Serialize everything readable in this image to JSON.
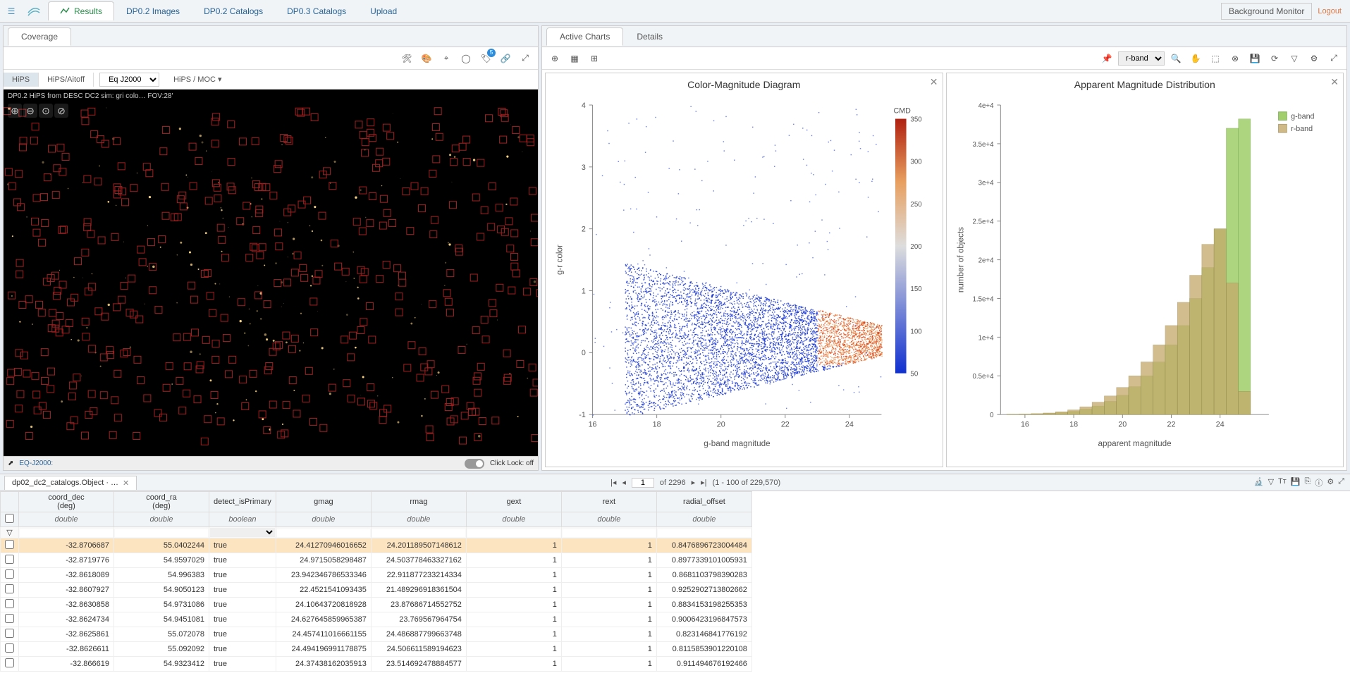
{
  "topbar": {
    "tabs": [
      {
        "label": "Results",
        "active": true
      },
      {
        "label": "DP0.2 Images"
      },
      {
        "label": "DP0.2 Catalogs"
      },
      {
        "label": "DP0.3 Catalogs"
      },
      {
        "label": "Upload"
      }
    ],
    "bg_monitor": "Background Monitor",
    "logout": "Logout"
  },
  "coverage": {
    "tab_label": "Coverage",
    "hips_label": "HiPS",
    "aitoff_label": "HiPS/Aitoff",
    "projection": "Eq J2000",
    "moc_label": "HiPS / MOC",
    "overlay_text": "DP0.2 HiPS from DESC DC2 sim: gri colo…   FOV:28'",
    "bottom_proj": "EQ-J2000:",
    "click_lock": "Click Lock: off",
    "layer_badge": "5"
  },
  "charts_panel": {
    "subtabs": [
      {
        "label": "Active Charts",
        "active": true
      },
      {
        "label": "Details"
      }
    ],
    "band_selector": "r-band",
    "chart1_title": "Color-Magnitude Diagram",
    "chart2_title": "Apparent Magnitude Distribution"
  },
  "chart_data": [
    {
      "type": "heatmap",
      "title": "Color-Magnitude Diagram",
      "xlabel": "g-band magnitude",
      "ylabel": "g-r color",
      "color_label": "CMD",
      "xlim": [
        16,
        25
      ],
      "ylim": [
        -1,
        4
      ],
      "xticks": [
        16,
        18,
        20,
        22,
        24
      ],
      "yticks": [
        -1,
        0,
        1,
        2,
        3,
        4
      ],
      "colorbar_ticks": [
        50,
        100,
        150,
        200,
        250,
        300,
        350
      ]
    },
    {
      "type": "bar",
      "title": "Apparent Magnitude Distribution",
      "xlabel": "apparent magnitude",
      "ylabel": "number of objects",
      "xlim": [
        15,
        26
      ],
      "ylim": [
        0,
        40000
      ],
      "xticks": [
        16,
        18,
        20,
        22,
        24
      ],
      "yticks": [
        0,
        5000,
        10000,
        15000,
        20000,
        25000,
        30000,
        35000,
        40000
      ],
      "ytick_labels": [
        "0",
        "0.5e+4",
        "1e+4",
        "1.5e+4",
        "2e+4",
        "2.5e+4",
        "3e+4",
        "3.5e+4",
        "4e+4"
      ],
      "legend": [
        "g-band",
        "r-band"
      ],
      "categories": [
        15.5,
        16,
        16.5,
        17,
        17.5,
        18,
        18.5,
        19,
        19.5,
        20,
        20.5,
        21,
        21.5,
        22,
        22.5,
        23,
        23.5,
        24,
        24.5,
        25
      ],
      "series": [
        {
          "name": "g-band",
          "values": [
            20,
            40,
            80,
            150,
            250,
            400,
            700,
            1100,
            1700,
            2500,
            3600,
            5000,
            6800,
            9000,
            11500,
            15000,
            19000,
            24000,
            37000,
            38200
          ]
        },
        {
          "name": "r-band",
          "values": [
            30,
            60,
            120,
            200,
            350,
            600,
            1000,
            1600,
            2400,
            3500,
            5000,
            6800,
            9000,
            11500,
            14500,
            18000,
            22000,
            24000,
            17000,
            3000
          ]
        }
      ]
    }
  ],
  "table": {
    "tab_label": "dp02_dc2_catalogs.Object · …",
    "pager": {
      "page": "1",
      "of_label": "of 2296",
      "range": "(1 - 100 of 229,570)"
    },
    "columns": [
      {
        "name": "coord_dec",
        "unit": "(deg)",
        "type": "double"
      },
      {
        "name": "coord_ra",
        "unit": "(deg)",
        "type": "double"
      },
      {
        "name": "detect_isPrimary",
        "unit": "",
        "type": "boolean"
      },
      {
        "name": "gmag",
        "unit": "",
        "type": "double"
      },
      {
        "name": "rmag",
        "unit": "",
        "type": "double"
      },
      {
        "name": "gext",
        "unit": "",
        "type": "double"
      },
      {
        "name": "rext",
        "unit": "",
        "type": "double"
      },
      {
        "name": "radial_offset",
        "unit": "",
        "type": "double"
      }
    ],
    "rows": [
      {
        "sel": true,
        "coord_dec": "-32.8706687",
        "coord_ra": "55.0402244",
        "detect_isPrimary": "true",
        "gmag": "24.41270946016652",
        "rmag": "24.201189507148612",
        "gext": "1",
        "rext": "1",
        "radial_offset": "0.8476896723004484"
      },
      {
        "coord_dec": "-32.8719776",
        "coord_ra": "54.9597029",
        "detect_isPrimary": "true",
        "gmag": "24.9715058298487",
        "rmag": "24.5037784633271​62",
        "gext": "1",
        "rext": "1",
        "radial_offset": "0.8977339101005931"
      },
      {
        "coord_dec": "-32.8618089",
        "coord_ra": "54.996383",
        "detect_isPrimary": "true",
        "gmag": "23.94234678653334​6",
        "rmag": "22.911877233214334",
        "gext": "1",
        "rext": "1",
        "radial_offset": "0.8681103798390283"
      },
      {
        "coord_dec": "-32.8607927",
        "coord_ra": "54.9050123",
        "detect_isPrimary": "true",
        "gmag": "22.4521541093435",
        "rmag": "21.489296918361504",
        "gext": "1",
        "rext": "1",
        "radial_offset": "0.9252902713802662"
      },
      {
        "coord_dec": "-32.8630858",
        "coord_ra": "54.9731086",
        "detect_isPrimary": "true",
        "gmag": "24.10643720818928",
        "rmag": "23.87686714552752",
        "gext": "1",
        "rext": "1",
        "radial_offset": "0.8834153198255353"
      },
      {
        "coord_dec": "-32.8624734",
        "coord_ra": "54.9451081",
        "detect_isPrimary": "true",
        "gmag": "24.627645859965387",
        "rmag": "23.769567964754",
        "gext": "1",
        "rext": "1",
        "radial_offset": "0.9006423196847573"
      },
      {
        "coord_dec": "-32.8625861",
        "coord_ra": "55.072078",
        "detect_isPrimary": "true",
        "gmag": "24.457411016661155",
        "rmag": "24.486887799663748",
        "gext": "1",
        "rext": "1",
        "radial_offset": "0.8231468417761​92"
      },
      {
        "coord_dec": "-32.8626611",
        "coord_ra": "55.092092",
        "detect_isPrimary": "true",
        "gmag": "24.494196991178875",
        "rmag": "24.506611589194623",
        "gext": "1",
        "rext": "1",
        "radial_offset": "0.81158539012201​08"
      },
      {
        "coord_dec": "-32.866619",
        "coord_ra": "54.9323412",
        "detect_isPrimary": "true",
        "gmag": "24.37438162035913",
        "rmag": "23.51469247888457​7",
        "gext": "1",
        "rext": "1",
        "radial_offset": "0.91149467619246​6"
      }
    ]
  }
}
